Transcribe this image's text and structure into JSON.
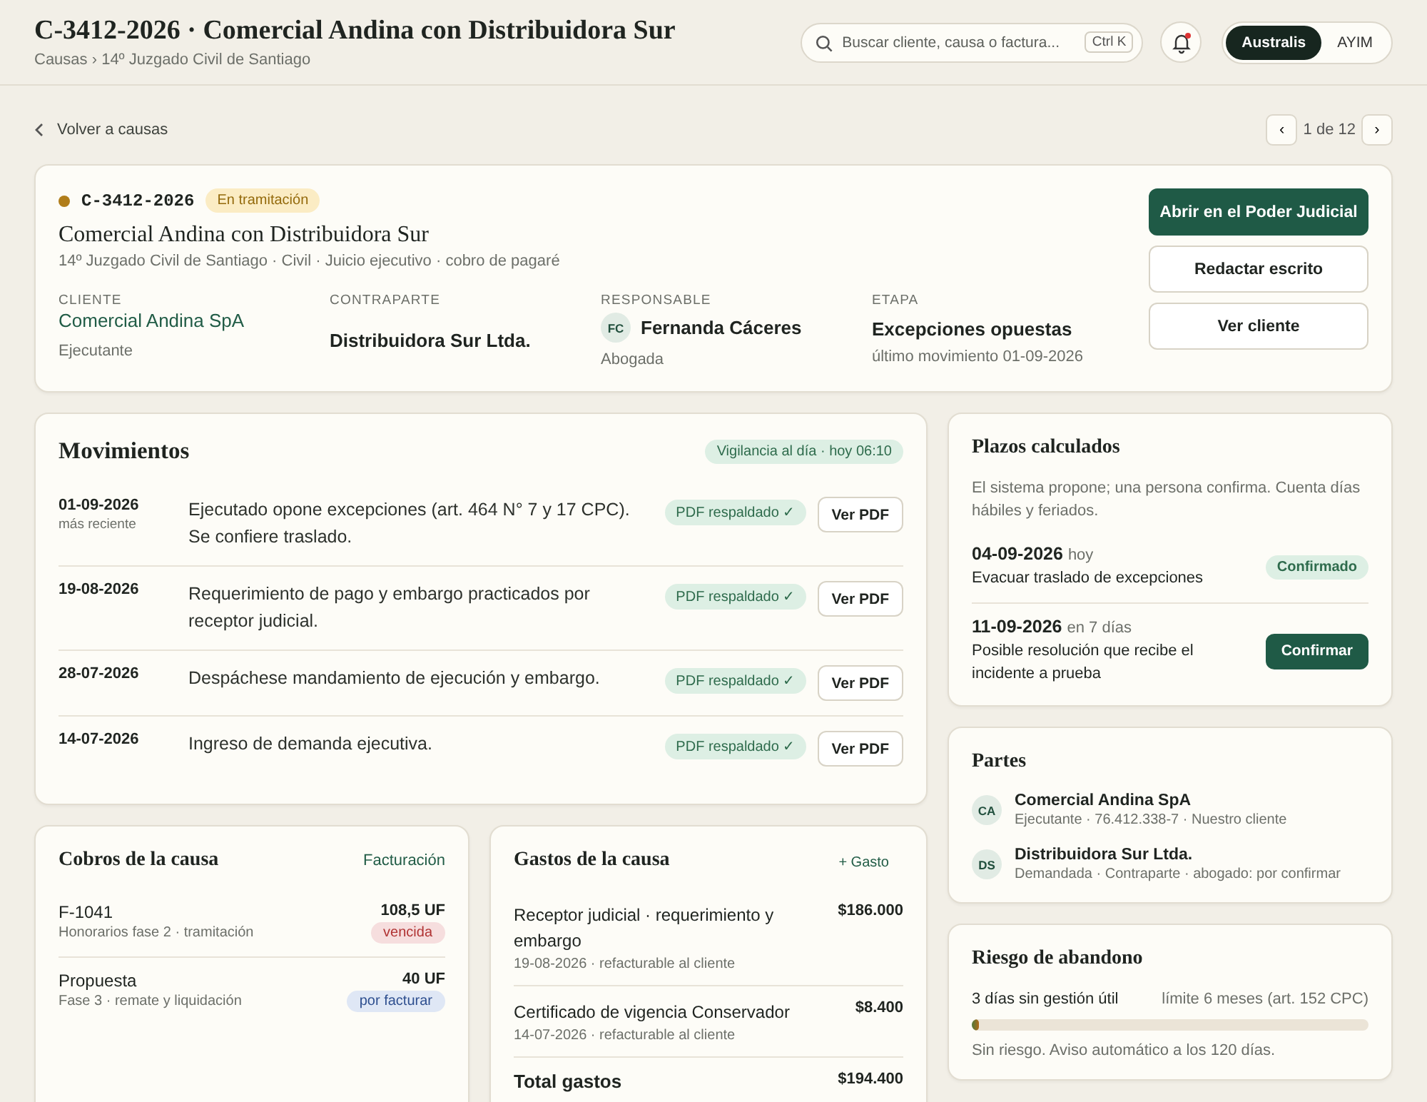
{
  "header": {
    "title": "C-3412-2026 · Comercial Andina con Distribuidora Sur",
    "breadcrumb": "Causas › 14º Juzgado Civil de Santiago",
    "search": {
      "placeholder": "Buscar cliente, causa o factura...",
      "shortcut": "Ctrl K"
    },
    "notifications": {
      "unread": true
    },
    "workspaces": [
      {
        "label": "Australis",
        "selected": true
      },
      {
        "label": "AYIM",
        "selected": false
      }
    ]
  },
  "nav": {
    "back": "Volver a causas",
    "pager": "1 de 12",
    "prev": "‹",
    "next": "›"
  },
  "case": {
    "color": "#b07d1a",
    "code": "C-3412-2026",
    "status": "En tramitación",
    "title": "Comercial Andina con Distribuidora Sur",
    "subtitle": "14º Juzgado Civil de Santiago · Civil · Juicio ejecutivo · cobro de pagaré",
    "fields": [
      {
        "kind": "link",
        "label": "CLIENTE",
        "value": "Comercial Andina SpA",
        "note": "Ejecutante"
      },
      {
        "kind": "plain",
        "label": "CONTRAPARTE",
        "value": "Distribuidora Sur Ltda."
      },
      {
        "kind": "person",
        "label": "RESPONSABLE",
        "initials": "FC",
        "value": "Fernanda Cáceres",
        "note": "Abogada"
      },
      {
        "kind": "plain",
        "label": "ETAPA",
        "value": "Excepciones opuestas",
        "note": "último movimiento 01-09-2026"
      }
    ],
    "actions": [
      {
        "label": "Abrir en el Poder Judicial",
        "primary": true
      },
      {
        "label": "Redactar escrito",
        "primary": false
      },
      {
        "label": "Ver cliente",
        "primary": false
      }
    ]
  },
  "movements": {
    "title": "Movimientos",
    "badge": "Vigilancia al día · hoy 06:10",
    "rows": [
      {
        "date": "01-09-2026",
        "note": "más reciente",
        "text": "Ejecutado opone excepciones (art. 464 N° 7 y 17 CPC). Se confiere traslado.",
        "tag": "PDF respaldado ✓",
        "button": "Ver PDF"
      },
      {
        "date": "19-08-2026",
        "text": "Requerimiento de pago y embargo practicados por receptor judicial.",
        "tag": "PDF respaldado ✓",
        "button": "Ver PDF"
      },
      {
        "date": "28-07-2026",
        "text": "Despáchese mandamiento de ejecución y embargo.",
        "tag": "PDF respaldado ✓",
        "button": "Ver PDF"
      },
      {
        "date": "14-07-2026",
        "text": "Ingreso de demanda ejecutiva.",
        "tag": "PDF respaldado ✓",
        "button": "Ver PDF"
      }
    ]
  },
  "billing": {
    "title": "Cobros de la causa",
    "link": "Facturación",
    "rows": [
      {
        "name": "F-1041",
        "detail": "Honorarios fase 2 · tramitación",
        "amount": "108,5 UF",
        "status": "vencida",
        "kind": "overdue"
      },
      {
        "name": "Propuesta",
        "detail": "Fase 3 · remate y liquidación",
        "amount": "40 UF",
        "status": "por facturar",
        "kind": "pending"
      }
    ]
  },
  "expenses": {
    "title": "Gastos de la causa",
    "link": "+ Gasto",
    "rows": [
      {
        "name": "Receptor judicial · requerimiento y embargo",
        "detail": "19-08-2026 · refacturable al cliente",
        "amount": "$186.000"
      },
      {
        "name": "Certificado de vigencia Conservador",
        "detail": "14-07-2026 · refacturable al cliente",
        "amount": "$8.400"
      }
    ],
    "total_label": "Total gastos",
    "total": "$194.400"
  },
  "deadlines": {
    "title": "Plazos calculados",
    "intro": "El sistema propone; una persona confirma. Cuenta días hábiles y feriados.",
    "items": [
      {
        "date": "04-09-2026",
        "when": "hoy",
        "text": "Evacuar traslado de excepciones",
        "confirmed": true,
        "action": "Confirmado"
      },
      {
        "date": "11-09-2026",
        "when": "en 7 días",
        "text": "Posible resolución que recibe el incidente a prueba",
        "confirmed": false,
        "action": "Confirmar"
      }
    ]
  },
  "parties": {
    "title": "Partes",
    "items": [
      {
        "initials": "CA",
        "name": "Comercial Andina SpA",
        "detail": "Ejecutante · 76.412.338-7 · Nuestro cliente"
      },
      {
        "initials": "DS",
        "name": "Distribuidora Sur Ltda.",
        "detail": "Demandada · Contraparte · abogado: por confirmar"
      }
    ]
  },
  "risk": {
    "title": "Riesgo de abandono",
    "left": "3 días sin gestión útil",
    "right": "límite 6 meses (art. 152 CPC)",
    "level": 0.01,
    "note": "Sin riesgo. Aviso automático a los 120 días."
  }
}
